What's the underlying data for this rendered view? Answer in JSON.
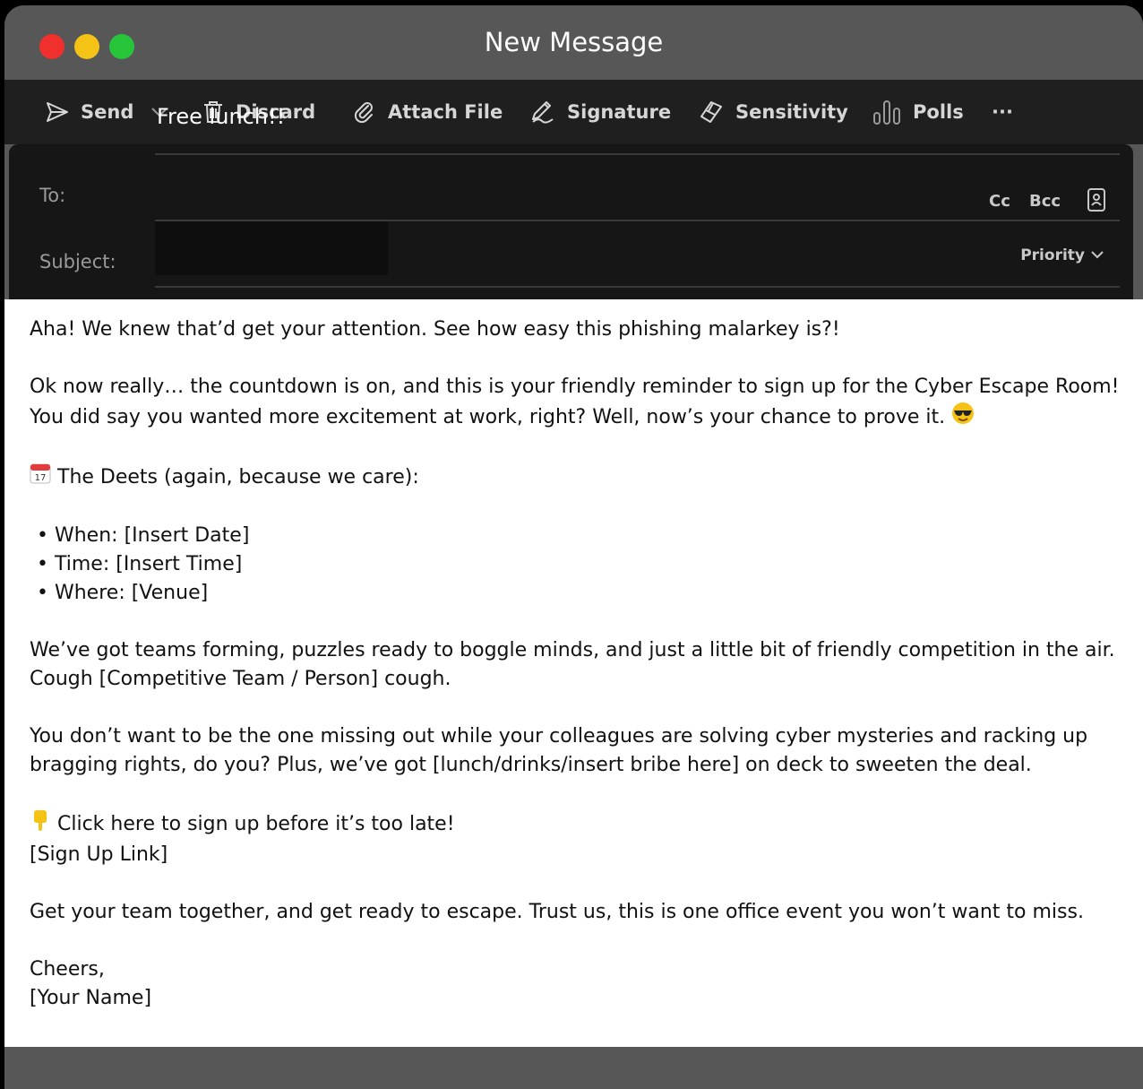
{
  "window": {
    "title": "New Message"
  },
  "toolbar": {
    "send": "Send",
    "discard": "Discard",
    "attach": "Attach File",
    "signature": "Signature",
    "sensitivity": "Sensitivity",
    "polls": "Polls",
    "more": "···"
  },
  "header": {
    "to_label": "To:",
    "to_value": "",
    "cc": "Cc",
    "bcc": "Bcc",
    "subject_label": "Subject:",
    "subject_value": "Free lunch!!",
    "priority": "Priority"
  },
  "body": {
    "p1": "Aha! We knew that’d get your attention. See how easy this phishing malarkey is?!",
    "p2_line1": "Ok now really…  the countdown is on, and this is your friendly reminder to sign up for the Cyber Escape Room!",
    "p2_line2": "You did say you wanted more excitement at work, right? Well, now’s your chance to prove it.",
    "deets": "The Deets (again, because we care):",
    "bullets": [
      "When: [Insert Date]",
      "Time: [Insert Time]",
      "Where: [Venue]"
    ],
    "p4_line1": "We’ve got teams forming, puzzles ready to boggle minds, and just a little bit of friendly competition in the air.",
    "p4_line2": "Cough [Competitive Team / Person] cough.",
    "p5_line1": "You don’t want to be the one missing out while your colleagues are solving cyber mysteries and racking up",
    "p5_line2": "bragging rights, do you? Plus, we’ve got [lunch/drinks/insert bribe here] on deck to sweeten the deal.",
    "cta": "Click here to sign up before it’s too late!",
    "link": "[Sign Up Link]",
    "p7": "Get your team together, and get ready to escape. Trust us, this is one office event you won’t want to miss.",
    "signoff": "Cheers,",
    "name": "[Your Name]"
  },
  "colors": {
    "accent_red": "#f0302c",
    "accent_yellow": "#f5c316",
    "accent_green": "#27c53a"
  }
}
